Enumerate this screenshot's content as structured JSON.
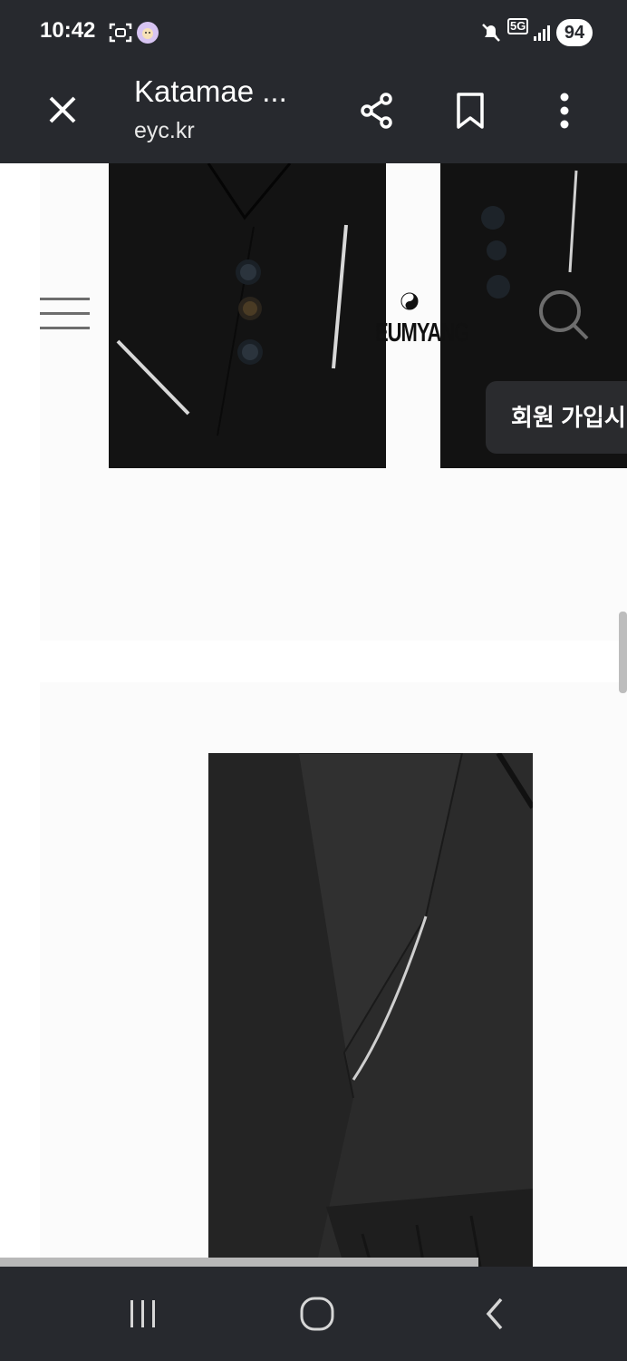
{
  "status_bar": {
    "time": "10:42",
    "network": "5G",
    "battery": "94",
    "icons": [
      "screenshot-icon",
      "app-avatar-icon",
      "mute-icon",
      "5g-icon",
      "signal-icon",
      "battery-icon"
    ]
  },
  "toolbar": {
    "title": "Katamae ...",
    "url": "eyc.kr",
    "icons": [
      "close-icon",
      "share-icon",
      "bookmark-icon",
      "more-icon"
    ]
  },
  "site": {
    "logo_text": "EUMYANG",
    "signup_text": "회원 가입시",
    "icons": [
      "menu-icon",
      "logo-symbol-icon",
      "search-icon"
    ]
  },
  "nav_bar": {
    "icons": [
      "recent-apps-icon",
      "home-icon",
      "back-icon"
    ]
  },
  "colors": {
    "chrome": "#27292e",
    "page_background": "#ffffff",
    "block_background": "#fbfbfb"
  }
}
